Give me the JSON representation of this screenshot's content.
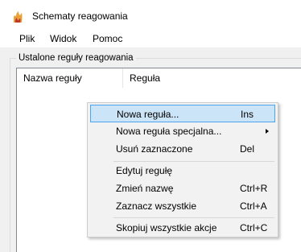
{
  "window": {
    "title": "Schematy reagowania",
    "icon": "flame-app-icon"
  },
  "menubar": {
    "items": [
      "Plik",
      "Widok",
      "Pomoc"
    ]
  },
  "group": {
    "caption": "Ustalone reguły reagowania"
  },
  "listview": {
    "columns": [
      "Nazwa reguły",
      "Reguła"
    ]
  },
  "context_menu": {
    "highlight_color": "#cce4f7",
    "items": [
      {
        "label": "Nowa reguła...",
        "shortcut": "Ins"
      },
      {
        "label": "Nowa reguła specjalna...",
        "shortcut": "",
        "submenu": "true"
      },
      {
        "label": "Usuń zaznaczone",
        "shortcut": "Del"
      },
      {
        "label": "Edytuj regułę",
        "shortcut": ""
      },
      {
        "label": "Zmień nazwę",
        "shortcut": "Ctrl+R"
      },
      {
        "label": "Zaznacz wszystkie",
        "shortcut": "Ctrl+A"
      },
      {
        "label": "Skopiuj wszystkie akcje",
        "shortcut": "Ctrl+C"
      }
    ]
  }
}
